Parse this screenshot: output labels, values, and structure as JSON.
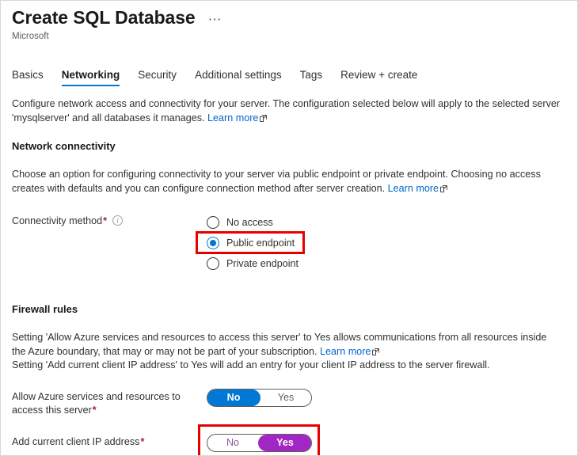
{
  "header": {
    "title": "Create SQL Database",
    "publisher": "Microsoft",
    "more_menu": "⋯"
  },
  "tabs": [
    {
      "label": "Basics",
      "active": false
    },
    {
      "label": "Networking",
      "active": true
    },
    {
      "label": "Security",
      "active": false
    },
    {
      "label": "Additional settings",
      "active": false
    },
    {
      "label": "Tags",
      "active": false
    },
    {
      "label": "Review + create",
      "active": false
    }
  ],
  "intro": {
    "text": "Configure network access and connectivity for your server. The configuration selected below will apply to the selected server 'mysqlserver' and all databases it manages. ",
    "link": "Learn more"
  },
  "network_connectivity": {
    "heading": "Network connectivity",
    "description": "Choose an option for configuring connectivity to your server via public endpoint or private endpoint. Choosing no access creates with defaults and you can configure connection method after server creation. ",
    "link": "Learn more",
    "field": {
      "label": "Connectivity method",
      "required_mark": "*",
      "info_icon": "info-icon"
    },
    "options": [
      {
        "label": "No access",
        "selected": false
      },
      {
        "label": "Public endpoint",
        "selected": true
      },
      {
        "label": "Private endpoint",
        "selected": false
      }
    ]
  },
  "firewall_rules": {
    "heading": "Firewall rules",
    "description_line1": "Setting 'Allow Azure services and resources to access this server' to Yes allows communications from all resources inside the Azure boundary, that may or may not be part of your subscription. ",
    "link": "Learn more",
    "description_line2": "Setting 'Add current client IP address' to Yes will add an entry for your client IP address to the server firewall.",
    "toggles": [
      {
        "label": "Allow Azure services and resources to access this server",
        "required_mark": "*",
        "off_label": "No",
        "on_label": "Yes",
        "value": "No",
        "accent": "#0078d4",
        "highlighted": false
      },
      {
        "label": "Add current client IP address",
        "required_mark": "*",
        "off_label": "No",
        "on_label": "Yes",
        "value": "Yes",
        "accent": "#a226c4",
        "highlighted": true
      }
    ]
  },
  "annotations": {
    "highlight_color": "#e60000",
    "highlighted_items": [
      "Public endpoint",
      "Add current client IP address toggle"
    ]
  }
}
